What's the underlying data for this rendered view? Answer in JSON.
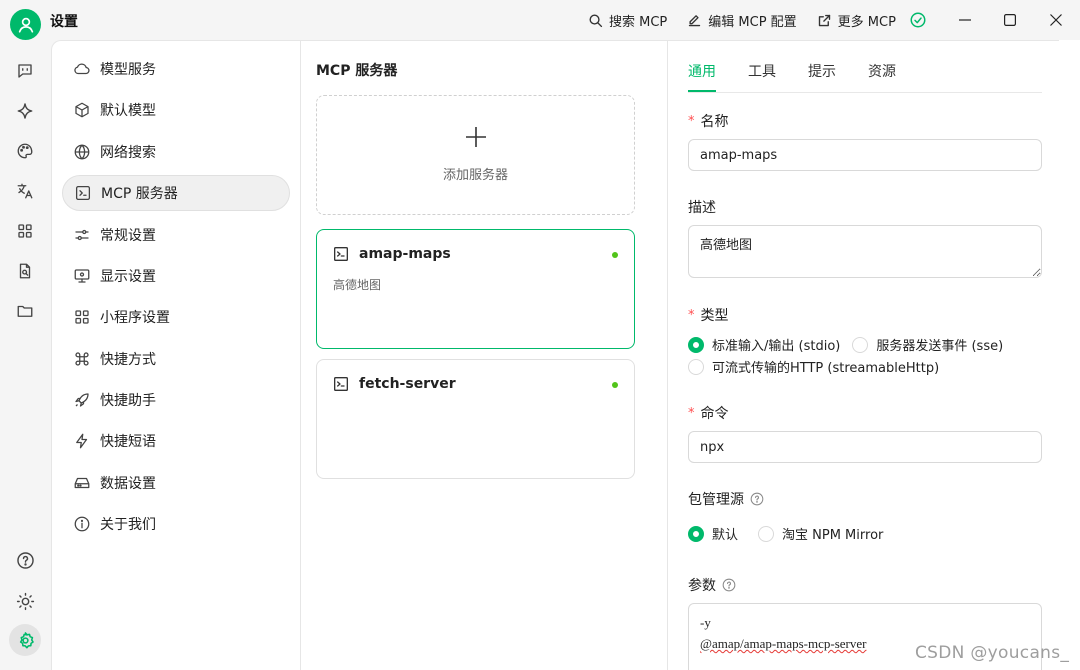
{
  "window": {
    "title": "设置",
    "actions": [
      {
        "label": "搜索 MCP",
        "icon": "search-icon"
      },
      {
        "label": "编辑 MCP 配置",
        "icon": "edit-icon"
      },
      {
        "label": "更多 MCP",
        "icon": "external-link-icon"
      }
    ]
  },
  "colors": {
    "accent": "#00b96b",
    "status_dot": "#52c41a",
    "required": "#ff4d4f"
  },
  "nav": {
    "items": [
      {
        "label": "模型服务",
        "icon": "cloud-icon"
      },
      {
        "label": "默认模型",
        "icon": "cube-icon"
      },
      {
        "label": "网络搜索",
        "icon": "globe-icon"
      },
      {
        "label": "MCP 服务器",
        "icon": "terminal-icon",
        "active": true
      },
      {
        "label": "常规设置",
        "icon": "sliders-icon"
      },
      {
        "label": "显示设置",
        "icon": "monitor-icon"
      },
      {
        "label": "小程序设置",
        "icon": "grid-icon"
      },
      {
        "label": "快捷方式",
        "icon": "command-icon"
      },
      {
        "label": "快捷助手",
        "icon": "rocket-icon"
      },
      {
        "label": "快捷短语",
        "icon": "lightning-icon"
      },
      {
        "label": "数据设置",
        "icon": "hard-drive-icon"
      },
      {
        "label": "关于我们",
        "icon": "info-icon"
      }
    ]
  },
  "servers": {
    "title": "MCP 服务器",
    "add_label": "添加服务器",
    "list": [
      {
        "name": "amap-maps",
        "description": "高德地图",
        "selected": true
      },
      {
        "name": "fetch-server",
        "description": "",
        "selected": false
      }
    ]
  },
  "detail": {
    "tabs": [
      "通用",
      "工具",
      "提示",
      "资源"
    ],
    "active_tab": "通用",
    "name_label": "名称",
    "name_value": "amap-maps",
    "desc_label": "描述",
    "desc_value": "高德地图",
    "type_label": "类型",
    "type_options": [
      "标准输入/输出 (stdio)",
      "服务器发送事件 (sse)",
      "可流式传输的HTTP (streamableHttp)"
    ],
    "type_selected": "标准输入/输出 (stdio)",
    "command_label": "命令",
    "command_value": "npx",
    "registry_label": "包管理源",
    "registry_options": [
      "默认",
      "淘宝 NPM Mirror"
    ],
    "registry_selected": "默认",
    "args_label": "参数",
    "args_lines": [
      "-y",
      "@amap/amap-maps-mcp-server"
    ]
  },
  "watermark": "CSDN @youcans_"
}
